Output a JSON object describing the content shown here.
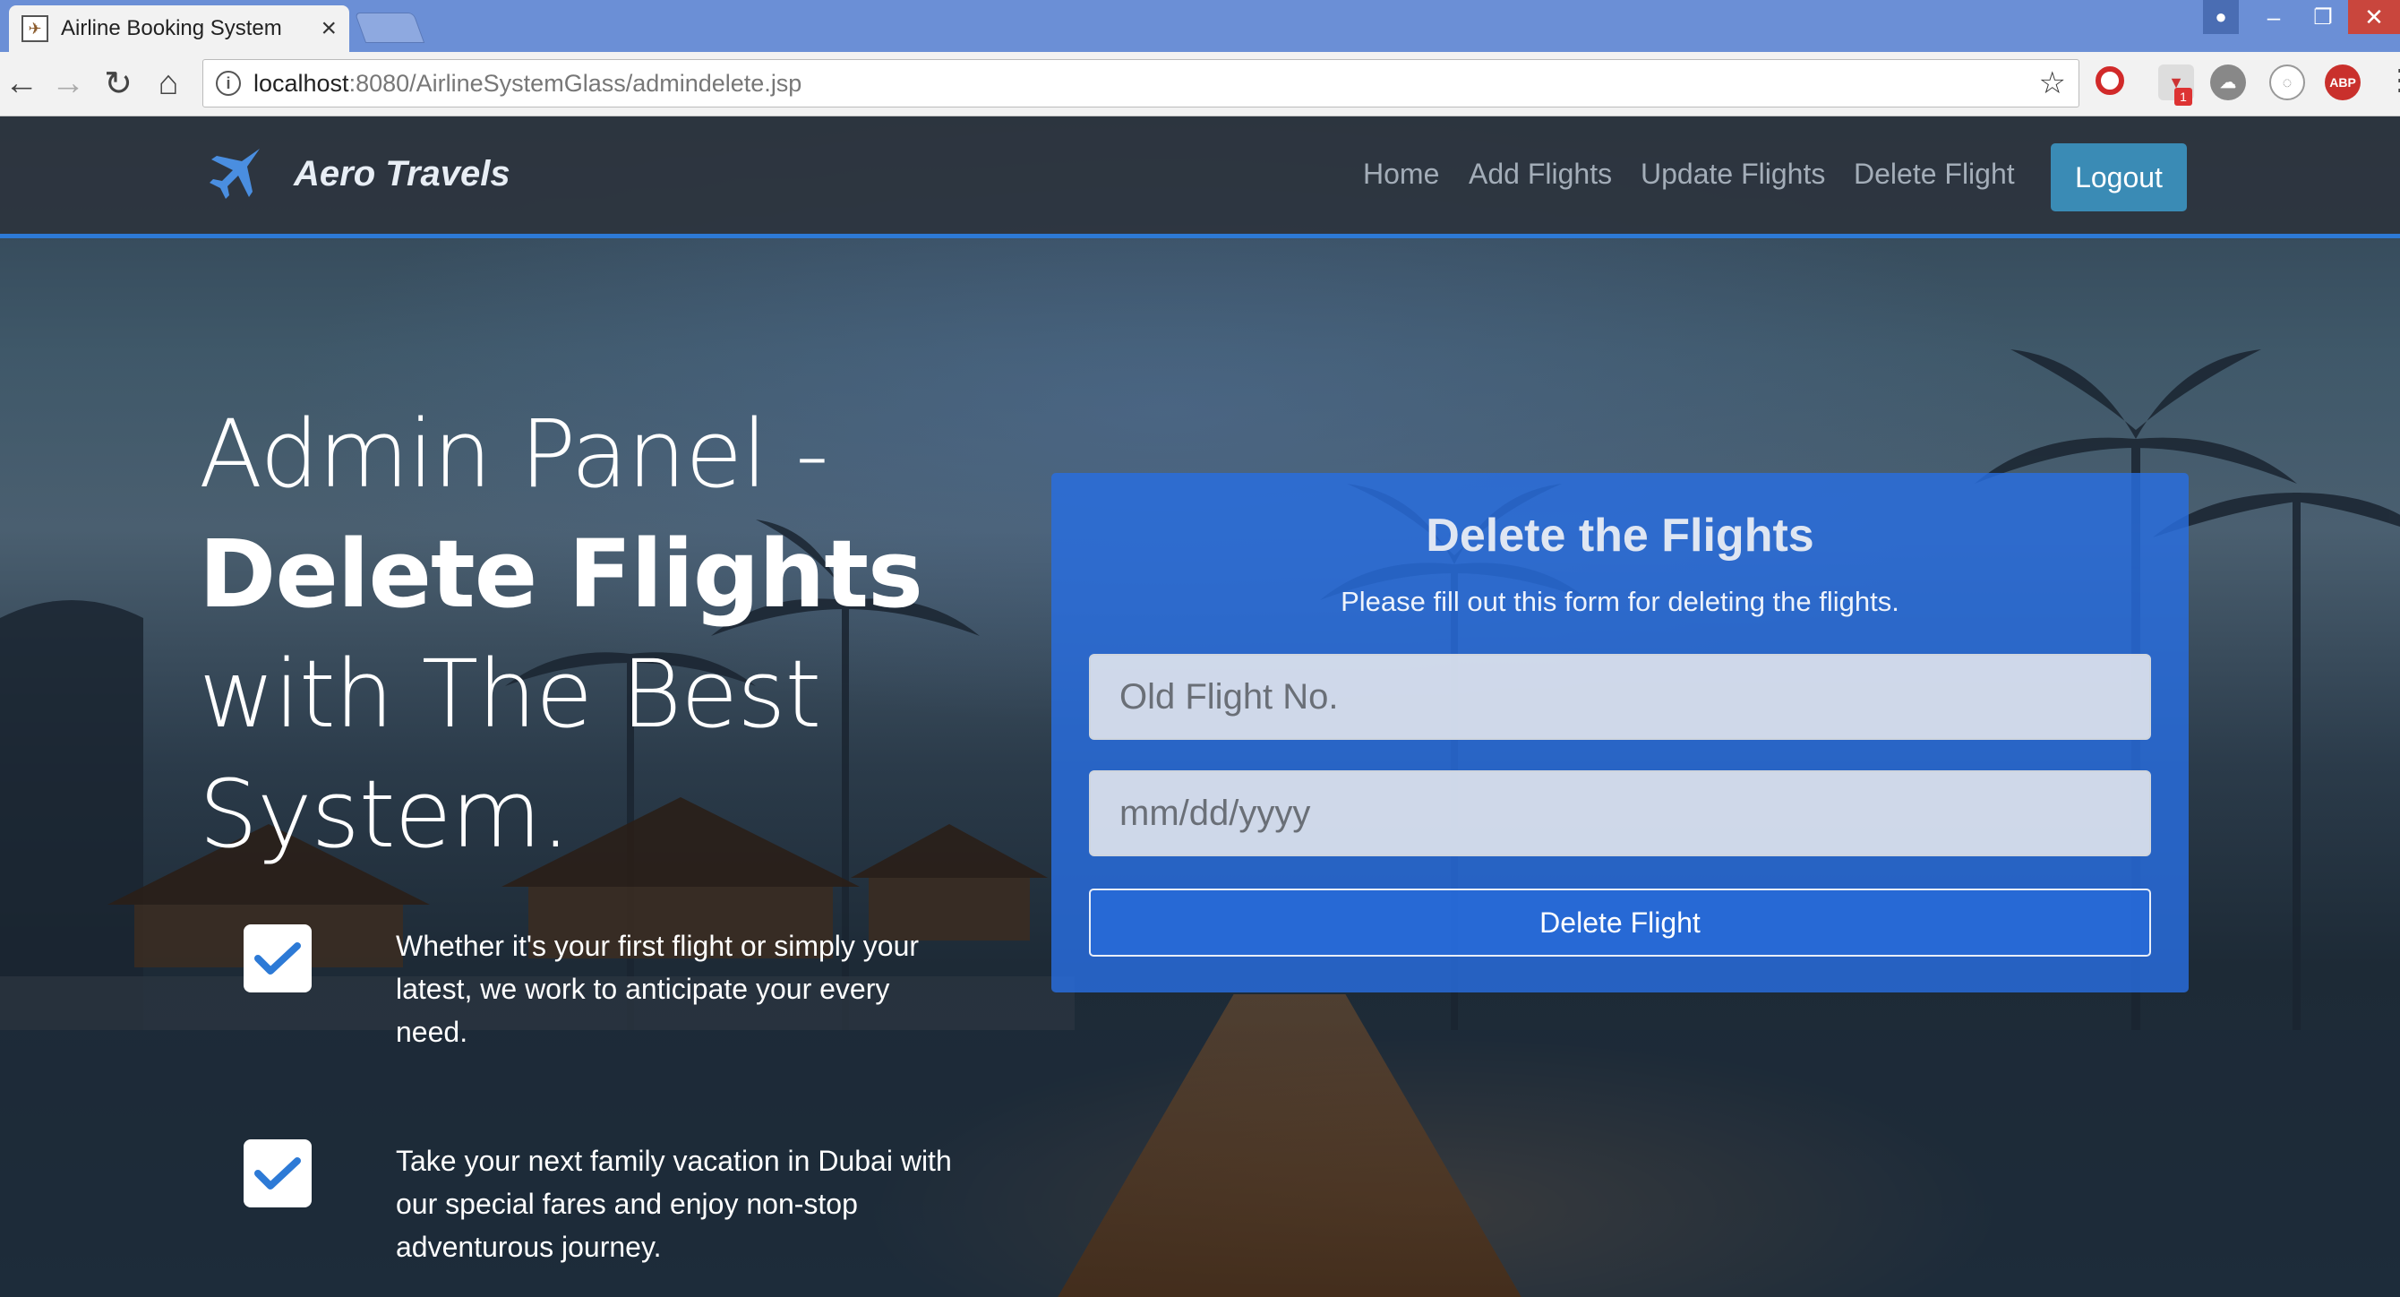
{
  "browser": {
    "tab_title": "Airline Booking System",
    "url_host": "localhost",
    "url_path": ":8080/AirlineSystemGlass/admindelete.jsp",
    "extension_badge": "1",
    "abp_label": "ABP"
  },
  "nav": {
    "brand": "Aero Travels",
    "links": [
      "Home",
      "Add Flights",
      "Update Flights",
      "Delete Flight"
    ],
    "logout": "Logout"
  },
  "hero": {
    "line1": "Admin Panel -",
    "line2": "Delete Flights",
    "line3": "with The Best",
    "line4": "System."
  },
  "features": [
    "Whether it's your first flight or simply your latest, we work to anticipate your every need.",
    "Take your next family vacation in Dubai with our special fares and enjoy non-stop adventurous journey."
  ],
  "form": {
    "title": "Delete the Flights",
    "subtitle": "Please fill out this form for deleting the flights.",
    "flight_placeholder": "Old Flight No.",
    "date_placeholder": "mm/dd/yyyy",
    "submit": "Delete Flight"
  },
  "colors": {
    "accent": "#2d7ad6",
    "logout_bg": "#3a8bb5",
    "form_bg": "#286ee1",
    "navbar_bg": "#2c343e"
  }
}
